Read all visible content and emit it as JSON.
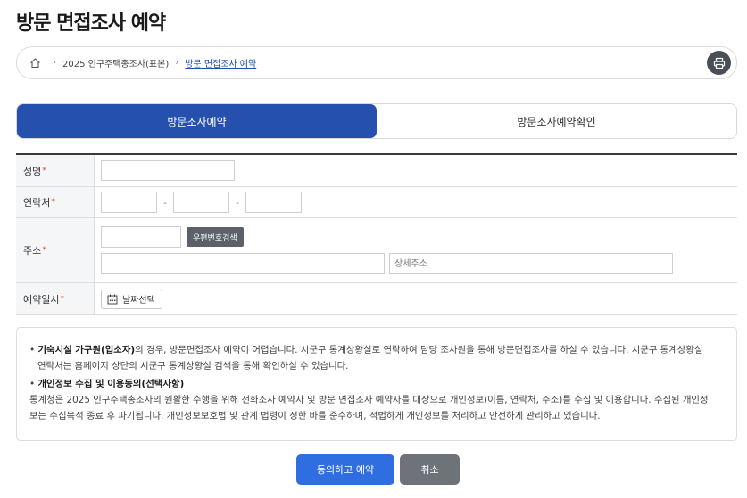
{
  "page": {
    "title": "방문 면접조사 예약"
  },
  "breadcrumb": {
    "level1": "2025 인구주택총조사(표본)",
    "current": "방문 면접조사 예약"
  },
  "tabs": [
    {
      "label": "방문조사예약",
      "active": true
    },
    {
      "label": "방문조사예약확인",
      "active": false
    }
  ],
  "form": {
    "required_mark": "*",
    "name_label": "성명",
    "contact_label": "연락처",
    "contact_sep": "-",
    "address_label": "주소",
    "zip_button": "우편번호검색",
    "detail_placeholder": "상세주소",
    "datetime_label": "예약일시",
    "date_button": "날짜선택"
  },
  "notice": {
    "b1_title": "기숙시설 가구원(입소자)",
    "b1_text": "의 경우, 방문면접조사 예약이 어렵습니다. 시군구 통계상황실로 연락하여 담당 조사원을 통해 방문면접조사를 하실 수 있습니다. 시군구 통계상황실",
    "b1_text2": "연락처는 홈페이지 상단의 시군구 통계상황실 검색을 통해 확인하실 수 있습니다.",
    "b2_title": "개인정보 수집 및 이용동의(선택사항)",
    "b2_line1": "통계청은 2025 인구주택총조사의 원활한 수행을 위해 전화조사 예약자 및 방문 면접조사 예약자를 대상으로 개인정보(이름, 연락처, 주소)를 수집 및 이용합니다. 수집된 개인정",
    "b2_line2": "보는 수집목적 종료 후 파기됩니다. 개인정보보호법 및 관계 법령이 정한 바를 준수하며, 적법하게 개인정보를 처리하고 안전하게 관리하고 있습니다.",
    "bullet": "•"
  },
  "actions": {
    "agree": "동의하고 예약",
    "cancel": "취소"
  },
  "colors": {
    "primary": "#2550ad",
    "button_primary": "#2f6ee0",
    "button_secondary": "#6e737a",
    "required": "#e03c31"
  },
  "icons": {
    "home": "home-icon",
    "print": "printer-icon",
    "calendar": "calendar-icon"
  }
}
